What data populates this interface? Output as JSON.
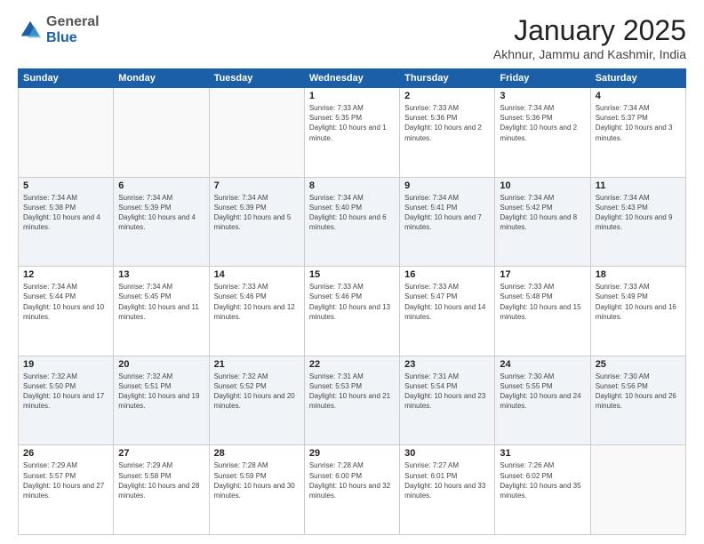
{
  "header": {
    "logo_line1": "General",
    "logo_line2": "Blue",
    "title": "January 2025",
    "subtitle": "Akhnur, Jammu and Kashmir, India"
  },
  "days_of_week": [
    "Sunday",
    "Monday",
    "Tuesday",
    "Wednesday",
    "Thursday",
    "Friday",
    "Saturday"
  ],
  "weeks": [
    [
      {
        "num": "",
        "sunrise": "",
        "sunset": "",
        "daylight": ""
      },
      {
        "num": "",
        "sunrise": "",
        "sunset": "",
        "daylight": ""
      },
      {
        "num": "",
        "sunrise": "",
        "sunset": "",
        "daylight": ""
      },
      {
        "num": "1",
        "sunrise": "Sunrise: 7:33 AM",
        "sunset": "Sunset: 5:35 PM",
        "daylight": "Daylight: 10 hours and 1 minute."
      },
      {
        "num": "2",
        "sunrise": "Sunrise: 7:33 AM",
        "sunset": "Sunset: 5:36 PM",
        "daylight": "Daylight: 10 hours and 2 minutes."
      },
      {
        "num": "3",
        "sunrise": "Sunrise: 7:34 AM",
        "sunset": "Sunset: 5:36 PM",
        "daylight": "Daylight: 10 hours and 2 minutes."
      },
      {
        "num": "4",
        "sunrise": "Sunrise: 7:34 AM",
        "sunset": "Sunset: 5:37 PM",
        "daylight": "Daylight: 10 hours and 3 minutes."
      }
    ],
    [
      {
        "num": "5",
        "sunrise": "Sunrise: 7:34 AM",
        "sunset": "Sunset: 5:38 PM",
        "daylight": "Daylight: 10 hours and 4 minutes."
      },
      {
        "num": "6",
        "sunrise": "Sunrise: 7:34 AM",
        "sunset": "Sunset: 5:39 PM",
        "daylight": "Daylight: 10 hours and 4 minutes."
      },
      {
        "num": "7",
        "sunrise": "Sunrise: 7:34 AM",
        "sunset": "Sunset: 5:39 PM",
        "daylight": "Daylight: 10 hours and 5 minutes."
      },
      {
        "num": "8",
        "sunrise": "Sunrise: 7:34 AM",
        "sunset": "Sunset: 5:40 PM",
        "daylight": "Daylight: 10 hours and 6 minutes."
      },
      {
        "num": "9",
        "sunrise": "Sunrise: 7:34 AM",
        "sunset": "Sunset: 5:41 PM",
        "daylight": "Daylight: 10 hours and 7 minutes."
      },
      {
        "num": "10",
        "sunrise": "Sunrise: 7:34 AM",
        "sunset": "Sunset: 5:42 PM",
        "daylight": "Daylight: 10 hours and 8 minutes."
      },
      {
        "num": "11",
        "sunrise": "Sunrise: 7:34 AM",
        "sunset": "Sunset: 5:43 PM",
        "daylight": "Daylight: 10 hours and 9 minutes."
      }
    ],
    [
      {
        "num": "12",
        "sunrise": "Sunrise: 7:34 AM",
        "sunset": "Sunset: 5:44 PM",
        "daylight": "Daylight: 10 hours and 10 minutes."
      },
      {
        "num": "13",
        "sunrise": "Sunrise: 7:34 AM",
        "sunset": "Sunset: 5:45 PM",
        "daylight": "Daylight: 10 hours and 11 minutes."
      },
      {
        "num": "14",
        "sunrise": "Sunrise: 7:33 AM",
        "sunset": "Sunset: 5:46 PM",
        "daylight": "Daylight: 10 hours and 12 minutes."
      },
      {
        "num": "15",
        "sunrise": "Sunrise: 7:33 AM",
        "sunset": "Sunset: 5:46 PM",
        "daylight": "Daylight: 10 hours and 13 minutes."
      },
      {
        "num": "16",
        "sunrise": "Sunrise: 7:33 AM",
        "sunset": "Sunset: 5:47 PM",
        "daylight": "Daylight: 10 hours and 14 minutes."
      },
      {
        "num": "17",
        "sunrise": "Sunrise: 7:33 AM",
        "sunset": "Sunset: 5:48 PM",
        "daylight": "Daylight: 10 hours and 15 minutes."
      },
      {
        "num": "18",
        "sunrise": "Sunrise: 7:33 AM",
        "sunset": "Sunset: 5:49 PM",
        "daylight": "Daylight: 10 hours and 16 minutes."
      }
    ],
    [
      {
        "num": "19",
        "sunrise": "Sunrise: 7:32 AM",
        "sunset": "Sunset: 5:50 PM",
        "daylight": "Daylight: 10 hours and 17 minutes."
      },
      {
        "num": "20",
        "sunrise": "Sunrise: 7:32 AM",
        "sunset": "Sunset: 5:51 PM",
        "daylight": "Daylight: 10 hours and 19 minutes."
      },
      {
        "num": "21",
        "sunrise": "Sunrise: 7:32 AM",
        "sunset": "Sunset: 5:52 PM",
        "daylight": "Daylight: 10 hours and 20 minutes."
      },
      {
        "num": "22",
        "sunrise": "Sunrise: 7:31 AM",
        "sunset": "Sunset: 5:53 PM",
        "daylight": "Daylight: 10 hours and 21 minutes."
      },
      {
        "num": "23",
        "sunrise": "Sunrise: 7:31 AM",
        "sunset": "Sunset: 5:54 PM",
        "daylight": "Daylight: 10 hours and 23 minutes."
      },
      {
        "num": "24",
        "sunrise": "Sunrise: 7:30 AM",
        "sunset": "Sunset: 5:55 PM",
        "daylight": "Daylight: 10 hours and 24 minutes."
      },
      {
        "num": "25",
        "sunrise": "Sunrise: 7:30 AM",
        "sunset": "Sunset: 5:56 PM",
        "daylight": "Daylight: 10 hours and 26 minutes."
      }
    ],
    [
      {
        "num": "26",
        "sunrise": "Sunrise: 7:29 AM",
        "sunset": "Sunset: 5:57 PM",
        "daylight": "Daylight: 10 hours and 27 minutes."
      },
      {
        "num": "27",
        "sunrise": "Sunrise: 7:29 AM",
        "sunset": "Sunset: 5:58 PM",
        "daylight": "Daylight: 10 hours and 28 minutes."
      },
      {
        "num": "28",
        "sunrise": "Sunrise: 7:28 AM",
        "sunset": "Sunset: 5:59 PM",
        "daylight": "Daylight: 10 hours and 30 minutes."
      },
      {
        "num": "29",
        "sunrise": "Sunrise: 7:28 AM",
        "sunset": "Sunset: 6:00 PM",
        "daylight": "Daylight: 10 hours and 32 minutes."
      },
      {
        "num": "30",
        "sunrise": "Sunrise: 7:27 AM",
        "sunset": "Sunset: 6:01 PM",
        "daylight": "Daylight: 10 hours and 33 minutes."
      },
      {
        "num": "31",
        "sunrise": "Sunrise: 7:26 AM",
        "sunset": "Sunset: 6:02 PM",
        "daylight": "Daylight: 10 hours and 35 minutes."
      },
      {
        "num": "",
        "sunrise": "",
        "sunset": "",
        "daylight": ""
      }
    ]
  ]
}
